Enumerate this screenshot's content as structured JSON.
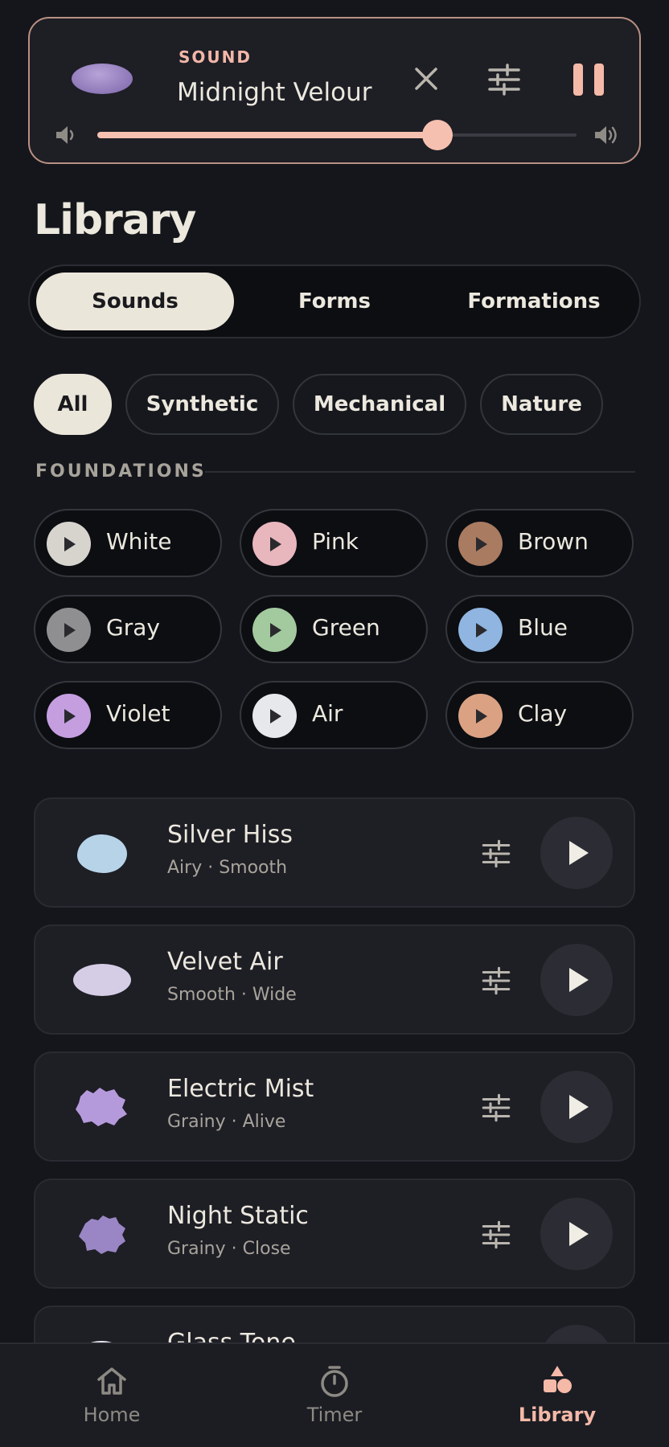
{
  "now_playing": {
    "kicker": "SOUND",
    "title": "Midnight Velour",
    "volume_percent": 71
  },
  "page_title": "Library",
  "tabs": [
    {
      "label": "Sounds",
      "active": true
    },
    {
      "label": "Forms",
      "active": false
    },
    {
      "label": "Formations",
      "active": false
    }
  ],
  "filters": [
    {
      "label": "All",
      "active": true
    },
    {
      "label": "Synthetic",
      "active": false
    },
    {
      "label": "Mechanical",
      "active": false
    },
    {
      "label": "Nature",
      "active": false
    }
  ],
  "section": {
    "title": "FOUNDATIONS"
  },
  "foundations": [
    {
      "label": "White",
      "color": "#d6d4cd"
    },
    {
      "label": "Pink",
      "color": "#e8b6bd"
    },
    {
      "label": "Brown",
      "color": "#a97b61"
    },
    {
      "label": "Gray",
      "color": "#8f8f91"
    },
    {
      "label": "Green",
      "color": "#a3c99e"
    },
    {
      "label": "Blue",
      "color": "#8fb5e0"
    },
    {
      "label": "Violet",
      "color": "#c59ee0"
    },
    {
      "label": "Air",
      "color": "#e6e8ec"
    },
    {
      "label": "Clay",
      "color": "#daa283"
    }
  ],
  "sounds": [
    {
      "title": "Silver Hiss",
      "subtitle": "Airy · Smooth",
      "blob_color": "#b6d3e8"
    },
    {
      "title": "Velvet Air",
      "subtitle": "Smooth · Wide",
      "blob_color": "#d5cde6"
    },
    {
      "title": "Electric Mist",
      "subtitle": "Grainy · Alive",
      "blob_color": "#b59adb"
    },
    {
      "title": "Night Static",
      "subtitle": "Grainy · Close",
      "blob_color": "#9a86c4"
    },
    {
      "title": "Glass Tone",
      "subtitle": "",
      "blob_color": "#e8e6ef"
    }
  ],
  "nav": [
    {
      "label": "Home",
      "icon": "home-icon",
      "active": false
    },
    {
      "label": "Timer",
      "icon": "timer-icon",
      "active": false
    },
    {
      "label": "Library",
      "icon": "library-shapes-icon",
      "active": true
    }
  ],
  "colors": {
    "accent": "#f5b9a8",
    "background": "#14161b",
    "card": "#1e1e25",
    "chip_active": "#ebe6da"
  }
}
